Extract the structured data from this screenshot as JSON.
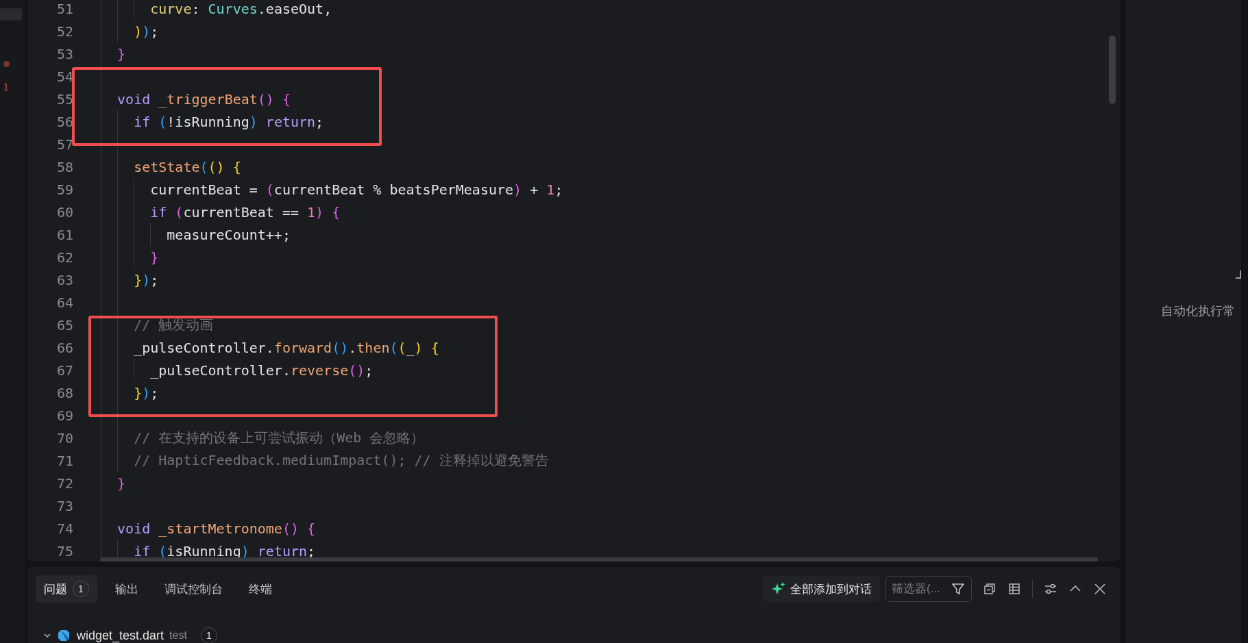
{
  "activity_bar": {
    "badge": "1"
  },
  "editor": {
    "lines": [
      {
        "number": "51",
        "boxed": false,
        "tokens": [
          {
            "kind": "prop",
            "text": "      curve"
          },
          {
            "kind": "plain",
            "text": ": "
          },
          {
            "kind": "type",
            "text": "Curves"
          },
          {
            "kind": "plain",
            "text": ".easeOut,"
          }
        ]
      },
      {
        "number": "52",
        "boxed": false,
        "tokens": [
          {
            "kind": "paren1",
            "text": "    )"
          },
          {
            "kind": "paren3",
            "text": ")"
          },
          {
            "kind": "plain",
            "text": ";"
          }
        ]
      },
      {
        "number": "53",
        "boxed": false,
        "tokens": [
          {
            "kind": "paren2",
            "text": "  }"
          }
        ]
      },
      {
        "number": "54",
        "boxed": true
      },
      {
        "number": "55",
        "boxed": true,
        "tokens": [
          {
            "kind": "keyword",
            "text": "  void "
          },
          {
            "kind": "func",
            "text": "_triggerBeat"
          },
          {
            "kind": "paren2",
            "text": "() {"
          }
        ]
      },
      {
        "number": "56",
        "boxed": true,
        "tokens": [
          {
            "kind": "keyword",
            "text": "    if "
          },
          {
            "kind": "paren3",
            "text": "("
          },
          {
            "kind": "plain",
            "text": "!isRunning"
          },
          {
            "kind": "paren3",
            "text": ") "
          },
          {
            "kind": "keyword",
            "text": "return"
          },
          {
            "kind": "plain",
            "text": ";"
          }
        ]
      },
      {
        "number": "57",
        "boxed": true
      },
      {
        "number": "58",
        "boxed": false,
        "tokens": [
          {
            "kind": "func",
            "text": "    setState"
          },
          {
            "kind": "paren3",
            "text": "("
          },
          {
            "kind": "paren1",
            "text": "() {"
          }
        ]
      },
      {
        "number": "59",
        "boxed": false,
        "tokens": [
          {
            "kind": "plain",
            "text": "      currentBeat = "
          },
          {
            "kind": "paren2",
            "text": "("
          },
          {
            "kind": "plain",
            "text": "currentBeat % beatsPerMeasure"
          },
          {
            "kind": "paren2",
            "text": ")"
          },
          {
            "kind": "plain",
            "text": " + "
          },
          {
            "kind": "num",
            "text": "1"
          },
          {
            "kind": "plain",
            "text": ";"
          }
        ]
      },
      {
        "number": "60",
        "boxed": false,
        "tokens": [
          {
            "kind": "keyword",
            "text": "      if "
          },
          {
            "kind": "paren2",
            "text": "("
          },
          {
            "kind": "plain",
            "text": "currentBeat == "
          },
          {
            "kind": "num",
            "text": "1"
          },
          {
            "kind": "paren2",
            "text": ") {"
          }
        ]
      },
      {
        "number": "61",
        "boxed": false,
        "tokens": [
          {
            "kind": "plain",
            "text": "        measureCount++;"
          }
        ]
      },
      {
        "number": "62",
        "boxed": false,
        "tokens": [
          {
            "kind": "paren2",
            "text": "      }"
          }
        ]
      },
      {
        "number": "63",
        "boxed": false,
        "tokens": [
          {
            "kind": "paren1",
            "text": "    }"
          },
          {
            "kind": "paren3",
            "text": ")"
          },
          {
            "kind": "plain",
            "text": ";"
          }
        ]
      },
      {
        "number": "64",
        "boxed": false
      },
      {
        "number": "65",
        "boxed": true,
        "tokens": [
          {
            "kind": "comment",
            "text": "    // 触发动画"
          }
        ]
      },
      {
        "number": "66",
        "boxed": true,
        "tokens": [
          {
            "kind": "plain",
            "text": "    _pulseController."
          },
          {
            "kind": "func",
            "text": "forward"
          },
          {
            "kind": "paren3",
            "text": "()"
          },
          {
            "kind": "plain",
            "text": "."
          },
          {
            "kind": "func",
            "text": "then"
          },
          {
            "kind": "paren3",
            "text": "("
          },
          {
            "kind": "paren1",
            "text": "("
          },
          {
            "kind": "plain",
            "text": "_"
          },
          {
            "kind": "paren1",
            "text": ") {"
          }
        ]
      },
      {
        "number": "67",
        "boxed": true,
        "tokens": [
          {
            "kind": "plain",
            "text": "      _pulseController."
          },
          {
            "kind": "func",
            "text": "reverse"
          },
          {
            "kind": "paren2",
            "text": "()"
          },
          {
            "kind": "plain",
            "text": ";"
          }
        ]
      },
      {
        "number": "68",
        "boxed": true,
        "tokens": [
          {
            "kind": "paren1",
            "text": "    }"
          },
          {
            "kind": "paren3",
            "text": ")"
          },
          {
            "kind": "plain",
            "text": ";"
          }
        ]
      },
      {
        "number": "69",
        "boxed": true
      },
      {
        "number": "70",
        "boxed": false,
        "tokens": [
          {
            "kind": "comment",
            "text": "    // 在支持的设备上可尝试振动（Web 会忽略）"
          }
        ]
      },
      {
        "number": "71",
        "boxed": false,
        "tokens": [
          {
            "kind": "comment",
            "text": "    // HapticFeedback.mediumImpact(); // 注释掉以避免警告"
          }
        ]
      },
      {
        "number": "72",
        "boxed": false,
        "tokens": [
          {
            "kind": "paren2",
            "text": "  }"
          }
        ]
      },
      {
        "number": "73",
        "boxed": false
      },
      {
        "number": "74",
        "boxed": false,
        "tokens": [
          {
            "kind": "keyword",
            "text": "  void "
          },
          {
            "kind": "func",
            "text": "_startMetronome"
          },
          {
            "kind": "paren2",
            "text": "() {"
          }
        ]
      },
      {
        "number": "75",
        "boxed": false,
        "tokens": [
          {
            "kind": "keyword",
            "text": "    if "
          },
          {
            "kind": "paren3",
            "text": "("
          },
          {
            "kind": "plain",
            "text": "isRunning"
          },
          {
            "kind": "paren3",
            "text": ") "
          },
          {
            "kind": "keyword",
            "text": "return"
          },
          {
            "kind": "plain",
            "text": ";"
          }
        ]
      }
    ]
  },
  "panel": {
    "tabs": [
      {
        "label": "问题",
        "badge": "1",
        "selected": true
      },
      {
        "label": "输出",
        "selected": false
      },
      {
        "label": "调试控制台",
        "selected": false
      },
      {
        "label": "终端",
        "selected": false
      }
    ],
    "add_button": "全部添加到对话",
    "filter": {
      "placeholder": "筛选器(..."
    },
    "tree": [
      {
        "file": "widget_test.dart",
        "folder": "test",
        "count": "1",
        "expanded": true
      }
    ]
  },
  "right_panel": {
    "text": "自动化执行常"
  }
}
